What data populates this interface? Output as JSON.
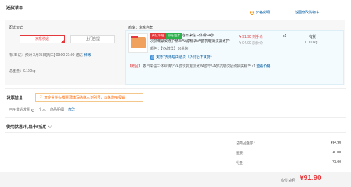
{
  "section": {
    "title": "送货清单",
    "price_note": "价格说明",
    "back_to_cart": "返回修改购物车"
  },
  "shipping": {
    "label": "配送方式",
    "jd_express": "京东快递",
    "door_pickup": "上门自提",
    "delivery_time": "标 准 达：预计 3月25日[周二] 09:00-21:00 送达",
    "modify": "修改",
    "total_weight": "总重量：0.110kg"
  },
  "store": {
    "name": "商家：京东自营"
  },
  "product": {
    "badge_1": "满亿补贴",
    "badge_2": "京东超市",
    "title_line1": "春日来信三体缘VA醇",
    "title_line2": "次抗皱紧致修护精华VA醇精华VA醇抗皱淡纹紧致护",
    "price": "¥ 91.90 到手价",
    "price_original": "¥ 94.90 原价价",
    "qty": "x1",
    "stock": "有货",
    "weight": "0.110kg",
    "color": "颜色：【VA醇华】30片装",
    "return_icon": "退",
    "return_policy": "支持7天无理由退货（拆封后不支持）",
    "gift_label": "【赠品】",
    "gift_text": "春日来信三体缘精华VA醇次抗皱紧致VA醇华VA醇抗皱纹紧致护肤精华 x1",
    "gift_link": "查看价格"
  },
  "invoice": {
    "title": "发票信息",
    "tip": "开企业抬头发票须填写纳税人识别号，以免影响报销",
    "type": "电子普通发票",
    "person": "个人",
    "detail": "商品明细",
    "modify": "修改"
  },
  "coupon": {
    "title": "使用优惠/礼品卡/抵用"
  },
  "summary": {
    "total_label": "总商品金额：",
    "total_value": "¥94.90",
    "freight_label": "运费：",
    "freight_value": "¥0.00",
    "gift_label": "礼金：",
    "gift_value": "-¥3.00",
    "pay_label": "应付总额：",
    "pay_value": "¥91.90"
  },
  "colors": {
    "accent_red": "#e4393c",
    "link_blue": "#005aa0",
    "badge_green": "#2bb24c"
  }
}
